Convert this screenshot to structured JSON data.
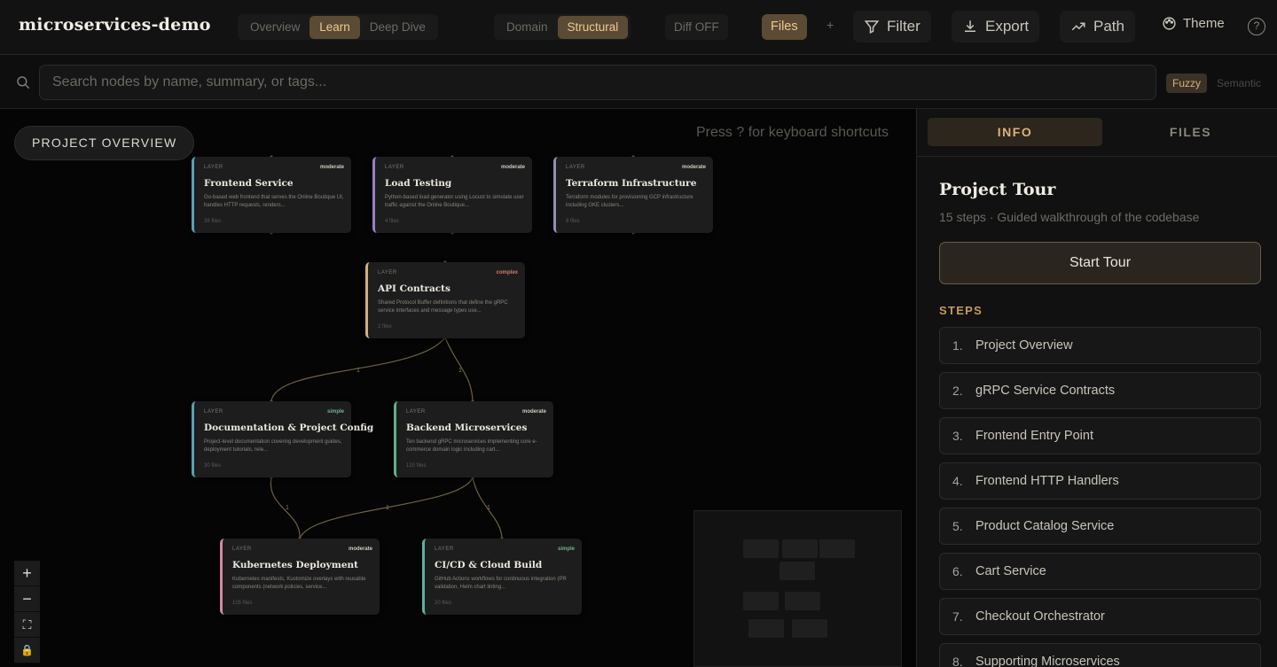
{
  "app": {
    "title": "microservices-demo"
  },
  "toolbar": {
    "levels": [
      "Overview",
      "Learn",
      "Deep Dive"
    ],
    "level_active": "Learn",
    "views": [
      "Domain",
      "Structural"
    ],
    "view_active": "Structural",
    "diff_label": "Diff OFF",
    "files_label": "Files",
    "plus_label": "+",
    "filter_label": "Filter",
    "export_label": "Export",
    "path_label": "Path",
    "theme_label": "Theme",
    "help_label": "?"
  },
  "search": {
    "placeholder": "Search nodes by name, summary, or tags...",
    "mode_fuzzy": "Fuzzy",
    "mode_semantic": "Semantic"
  },
  "canvas": {
    "overview_button": "PROJECT OVERVIEW",
    "shortcut_hint": "Press ? for keyboard shortcuts",
    "zoom_in": "+",
    "zoom_out": "−",
    "fit": "⛶",
    "lock": "🔒"
  },
  "nodes": [
    {
      "tag": "LAYER",
      "complexity": "moderate",
      "title": "Frontend Service",
      "summary": "Go-based web frontend that serves the Online Boutique UI, handles HTTP requests, renders...",
      "files": "38 files",
      "color": "#5aa0b4"
    },
    {
      "tag": "LAYER",
      "complexity": "moderate",
      "title": "Load Testing",
      "summary": "Python-based load generator using Locust to simulate user traffic against the Online Boutique...",
      "files": "4 files",
      "color": "#9a7fc8"
    },
    {
      "tag": "LAYER",
      "complexity": "moderate",
      "title": "Terraform Infrastructure",
      "summary": "Terraform modules for provisioning GCP infrastructure including GKE clusters...",
      "files": "9 files",
      "color": "#8f8fb8"
    },
    {
      "tag": "LAYER",
      "complexity": "complex",
      "title": "API Contracts",
      "summary": "Shared Protocol Buffer definitions that define the gRPC service interfaces and message types use...",
      "files": "2 files",
      "color": "#d2b07a"
    },
    {
      "tag": "LAYER",
      "complexity": "simple",
      "title": "Documentation & Project Config",
      "summary": "Project-level documentation covering development guides, deployment tutorials, rele...",
      "files": "30 files",
      "color": "#5aa0b4"
    },
    {
      "tag": "LAYER",
      "complexity": "moderate",
      "title": "Backend Microservices",
      "summary": "Ten backend gRPC microservices implementing core e-commerce domain logic including cart...",
      "files": "120 files",
      "color": "#5fb08a"
    },
    {
      "tag": "LAYER",
      "complexity": "moderate",
      "title": "Kubernetes Deployment",
      "summary": "Kubernetes manifests, Kustomize overlays with reusable components (network policies, service...",
      "files": "105 files",
      "color": "#d08aa0"
    },
    {
      "tag": "LAYER",
      "complexity": "simple",
      "title": "CI/CD & Cloud Build",
      "summary": "GitHub Actions workflows for continuous integration (PR validation, Helm chart linting...",
      "files": "20 files",
      "color": "#5fb0a0"
    }
  ],
  "edge_labels": [
    "1",
    "1",
    "1",
    "1",
    "1"
  ],
  "panel": {
    "tab_info": "INFO",
    "tab_files": "FILES",
    "tour_title": "Project Tour",
    "tour_subtitle": "15 steps · Guided walkthrough of the codebase",
    "start_button": "Start Tour",
    "steps_label": "STEPS",
    "steps": [
      {
        "num": "1.",
        "label": "Project Overview"
      },
      {
        "num": "2.",
        "label": "gRPC Service Contracts"
      },
      {
        "num": "3.",
        "label": "Frontend Entry Point"
      },
      {
        "num": "4.",
        "label": "Frontend HTTP Handlers"
      },
      {
        "num": "5.",
        "label": "Product Catalog Service"
      },
      {
        "num": "6.",
        "label": "Cart Service"
      },
      {
        "num": "7.",
        "label": "Checkout Orchestrator"
      },
      {
        "num": "8.",
        "label": "Supporting Microservices"
      }
    ]
  }
}
